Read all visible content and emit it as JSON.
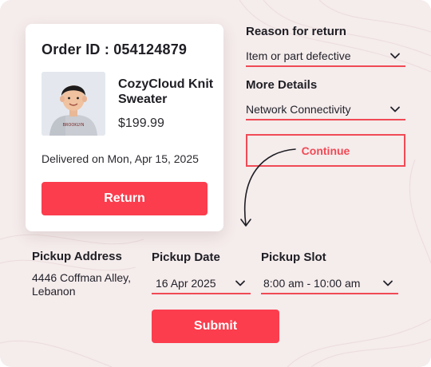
{
  "order": {
    "id_label": "Order ID : 054124879",
    "product_name": "CozyCloud Knit Sweater",
    "price": "$199.99",
    "delivered": "Delivered on Mon, Apr 15, 2025",
    "return_label": "Return",
    "shirt_text": "BROOKLYN"
  },
  "reason": {
    "label": "Reason for return",
    "value": "Item or part defective"
  },
  "details": {
    "label": "More Details",
    "value": "Network Connectivity"
  },
  "continue_label": "Continue",
  "pickup": {
    "address_label": "Pickup Address",
    "address": "4446 Coffman Alley, Lebanon",
    "date_label": "Pickup Date",
    "date": "16 Apr 2025",
    "slot_label": "Pickup Slot",
    "slot": "8:00 am - 10:00 am"
  },
  "submit_label": "Submit",
  "colors": {
    "accent": "#fb3d4d",
    "underline": "#f04a55",
    "background": "#f5ecec"
  },
  "icons": [
    "chevron-down-icon",
    "curved-arrow-icon"
  ]
}
